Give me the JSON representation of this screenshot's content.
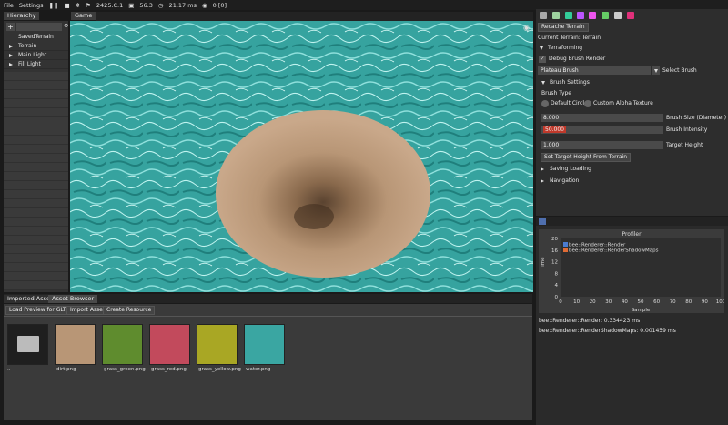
{
  "menubar": {
    "file": "File",
    "settings": "Settings",
    "tag_value": "2425.C.1",
    "fps": "56.3",
    "frame_ms": "21.17 ms",
    "camera": "0 [0]"
  },
  "hierarchy": {
    "tab": "Hierarchy",
    "scene": "SavedTerrain",
    "items": [
      "Terrain",
      "Main Light",
      "Fill Light"
    ]
  },
  "game": {
    "tab": "Game"
  },
  "inspector": {
    "recache_button": "Recache Terrain",
    "current_terrain": "Current Terrain: Terrain",
    "terraforming": "Terraforming",
    "debug_brush": "Debug Brush Render",
    "brush_select_value": "Plateau Brush",
    "select_brush_label": "Select Brush",
    "brush_settings": "Brush Settings",
    "brush_type_label": "Brush Type",
    "brush_type_options": [
      "Default Circle",
      "Custom Alpha Texture"
    ],
    "brush_size_value": "8.000",
    "brush_size_label": "Brush Size (Diameter)",
    "brush_intensity_value": "50.000",
    "brush_intensity_label": "Brush Intensity",
    "target_height_value": "1.000",
    "target_height_label": "Target Height",
    "set_target_button": "Set Target Height From Terrain",
    "saving_loading": "Saving Loading",
    "navigation": "Navigation"
  },
  "profiler": {
    "title": "Profiler",
    "legend": [
      "bee::Renderer::Render",
      "bee::Renderer::RenderShadowMaps"
    ],
    "ylabel": "Time",
    "xlabel": "Sample",
    "y_ticks": [
      "20",
      "16",
      "12",
      "8",
      "4",
      "0"
    ],
    "x_ticks": [
      "0",
      "10",
      "20",
      "30",
      "40",
      "50",
      "60",
      "70",
      "80",
      "90",
      "100"
    ],
    "stat_render": "bee::Renderer::Render: 0.334423 ms",
    "stat_shadow": "bee::Renderer::RenderShadowMaps: 0.001459 ms"
  },
  "chart_data": {
    "type": "line",
    "title": "Profiler",
    "xlabel": "Sample",
    "ylabel": "Time",
    "xlim": [
      0,
      100
    ],
    "ylim": [
      0,
      20
    ],
    "series": [
      {
        "name": "bee::Renderer::Render",
        "values": []
      },
      {
        "name": "bee::Renderer::RenderShadowMaps",
        "values": []
      }
    ]
  },
  "assets": {
    "tabs": [
      "Imported Assets",
      "Asset Browser"
    ],
    "buttons": [
      "Load Preview for GLTFs",
      "Import Asset",
      "Create Resource"
    ],
    "files": [
      {
        "name": "..",
        "color": "#444444"
      },
      {
        "name": "dirt.png",
        "color": "#b89676"
      },
      {
        "name": "grass_green.png",
        "color": "#5f8c2e"
      },
      {
        "name": "grass_red.png",
        "color": "#c24a5c"
      },
      {
        "name": "grass_yellow.png",
        "color": "#a9a724"
      },
      {
        "name": "water.png",
        "color": "#3aa6a2"
      }
    ]
  },
  "colors": {
    "water": "#3aa4a0",
    "dirt": "#c2a283",
    "accent_red": "#c0392b"
  }
}
